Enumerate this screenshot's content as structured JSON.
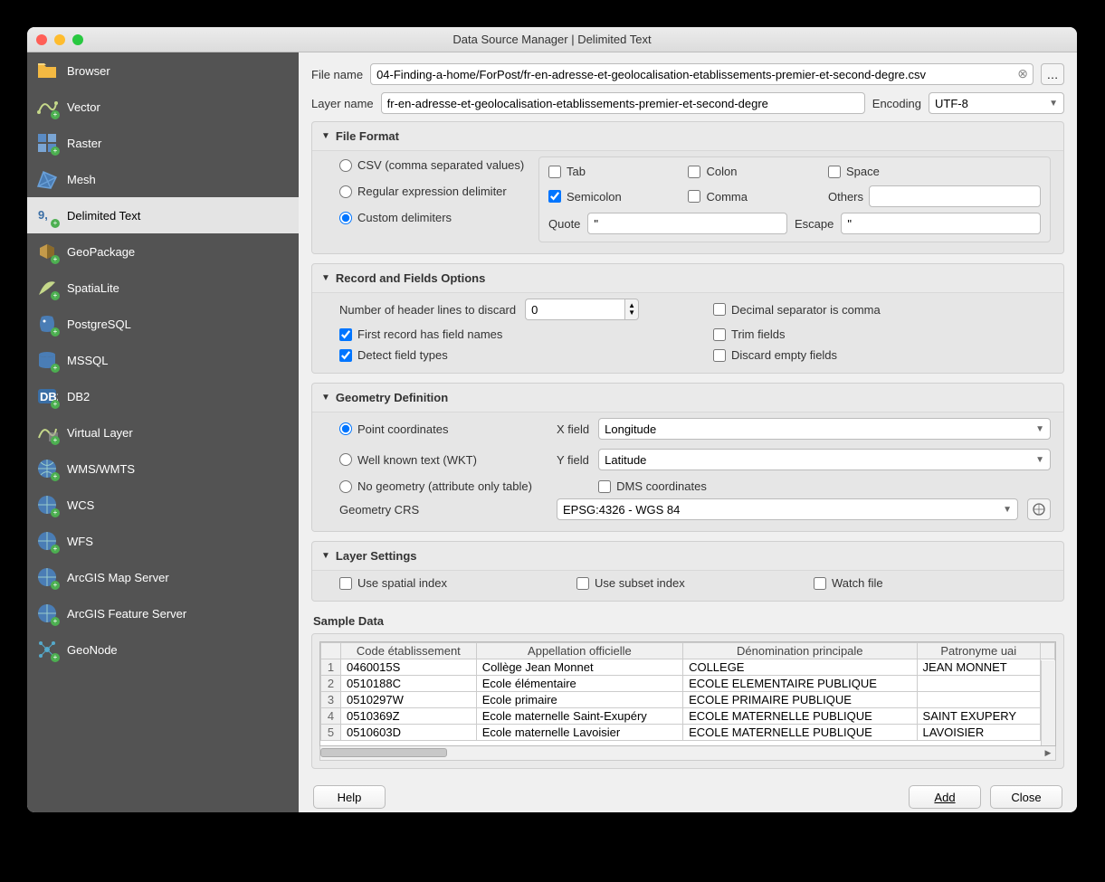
{
  "title": "Data Source Manager | Delimited Text",
  "sidebar": {
    "items": [
      {
        "label": "Browser"
      },
      {
        "label": "Vector"
      },
      {
        "label": "Raster"
      },
      {
        "label": "Mesh"
      },
      {
        "label": "Delimited Text"
      },
      {
        "label": "GeoPackage"
      },
      {
        "label": "SpatiaLite"
      },
      {
        "label": "PostgreSQL"
      },
      {
        "label": "MSSQL"
      },
      {
        "label": "DB2"
      },
      {
        "label": "Virtual Layer"
      },
      {
        "label": "WMS/WMTS"
      },
      {
        "label": "WCS"
      },
      {
        "label": "WFS"
      },
      {
        "label": "ArcGIS Map Server"
      },
      {
        "label": "ArcGIS Feature Server"
      },
      {
        "label": "GeoNode"
      }
    ]
  },
  "file": {
    "name_label": "File name",
    "name_value": "04-Finding-a-home/ForPost/fr-en-adresse-et-geolocalisation-etablissements-premier-et-second-degre.csv",
    "browse": "…",
    "layer_label": "Layer name",
    "layer_value": "fr-en-adresse-et-geolocalisation-etablissements-premier-et-second-degre",
    "encoding_label": "Encoding",
    "encoding_value": "UTF-8"
  },
  "file_format": {
    "title": "File Format",
    "csv": "CSV (comma separated values)",
    "regex": "Regular expression delimiter",
    "custom": "Custom delimiters",
    "tab": "Tab",
    "colon": "Colon",
    "space": "Space",
    "semicolon": "Semicolon",
    "comma": "Comma",
    "others": "Others",
    "quote": "Quote",
    "quote_val": "\"",
    "escape": "Escape",
    "escape_val": "\""
  },
  "records": {
    "title": "Record and Fields Options",
    "header_lines": "Number of header lines to discard",
    "header_val": "0",
    "first_names": "First record has field names",
    "detect": "Detect field types",
    "decimal": "Decimal separator is comma",
    "trim": "Trim fields",
    "discard": "Discard empty fields"
  },
  "geometry": {
    "title": "Geometry Definition",
    "point": "Point coordinates",
    "wkt": "Well known text (WKT)",
    "none": "No geometry (attribute only table)",
    "xfield": "X field",
    "xval": "Longitude",
    "yfield": "Y field",
    "yval": "Latitude",
    "dms": "DMS coordinates",
    "crs_label": "Geometry CRS",
    "crs_value": "EPSG:4326 - WGS 84"
  },
  "layer_settings": {
    "title": "Layer Settings",
    "spatial": "Use spatial index",
    "subset": "Use subset index",
    "watch": "Watch file"
  },
  "sample": {
    "title": "Sample Data",
    "headers": [
      "Code établissement",
      "Appellation officielle",
      "Dénomination principale",
      "Patronyme uai"
    ],
    "rows": [
      [
        "0460015S",
        "Collège Jean Monnet",
        "COLLEGE",
        "JEAN MONNET"
      ],
      [
        "0510188C",
        "Ecole élémentaire",
        "ECOLE ELEMENTAIRE PUBLIQUE",
        ""
      ],
      [
        "0510297W",
        "Ecole primaire",
        "ECOLE PRIMAIRE PUBLIQUE",
        ""
      ],
      [
        "0510369Z",
        "Ecole maternelle Saint-Exupéry",
        "ECOLE MATERNELLE PUBLIQUE",
        "SAINT EXUPERY"
      ],
      [
        "0510603D",
        "Ecole maternelle Lavoisier",
        "ECOLE MATERNELLE PUBLIQUE",
        "LAVOISIER"
      ]
    ]
  },
  "buttons": {
    "help": "Help",
    "add": "Add",
    "close": "Close"
  }
}
